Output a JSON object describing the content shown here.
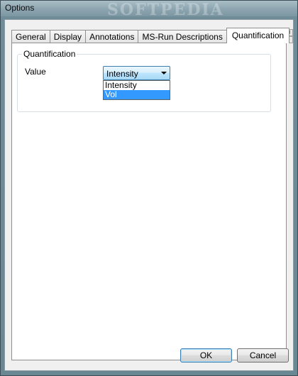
{
  "window": {
    "title": "Options",
    "watermark": "SOFTPEDIA"
  },
  "tabs": [
    {
      "label": "General",
      "active": false
    },
    {
      "label": "Display",
      "active": false
    },
    {
      "label": "Annotations",
      "active": false
    },
    {
      "label": "MS-Run Descriptions",
      "active": false
    },
    {
      "label": "Quantification",
      "active": true
    }
  ],
  "quantification": {
    "group_title": "Quantification",
    "value_label": "Value",
    "combo_value": "Intensity",
    "options": [
      {
        "label": "Intensity",
        "highlighted": false
      },
      {
        "label": "Vol",
        "highlighted": true
      }
    ]
  },
  "buttons": {
    "ok": "OK",
    "cancel": "Cancel"
  },
  "icons": {
    "combo_arrow": "chevron-down-icon",
    "tab_scroll_left": "arrow-left-icon",
    "tab_scroll_right": "arrow-right-icon"
  },
  "colors": {
    "selection": "#3399ff",
    "focus_border": "#3c7fb1"
  }
}
